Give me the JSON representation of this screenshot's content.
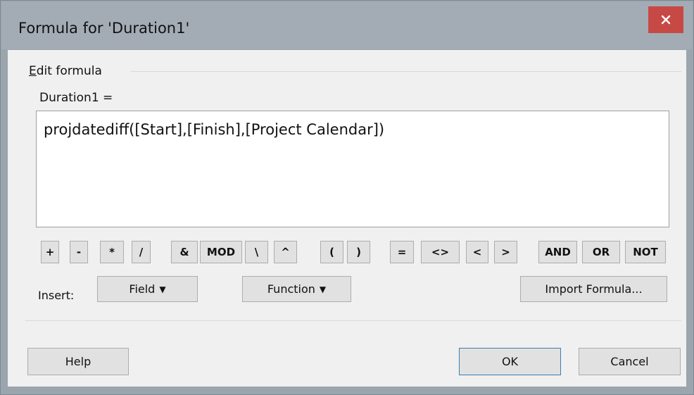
{
  "window": {
    "title": "Formula for 'Duration1'"
  },
  "group": {
    "label_underlined": "E",
    "label_rest": "dit formula"
  },
  "formula": {
    "label": "Duration1 =",
    "value": "projdatediff([Start],[Finish],[Project Calendar])"
  },
  "operators": [
    "+",
    "-",
    "*",
    "/",
    "&",
    "MOD",
    "\\",
    "^",
    "(",
    ")",
    "=",
    "<>",
    "<",
    ">",
    "AND",
    "OR",
    "NOT"
  ],
  "insert": {
    "label": "Insert:",
    "field_label": "Field",
    "function_label": "Function",
    "import_label": "Import Formula..."
  },
  "footer": {
    "help_label": "Help",
    "ok_label": "OK",
    "cancel_label": "Cancel"
  }
}
